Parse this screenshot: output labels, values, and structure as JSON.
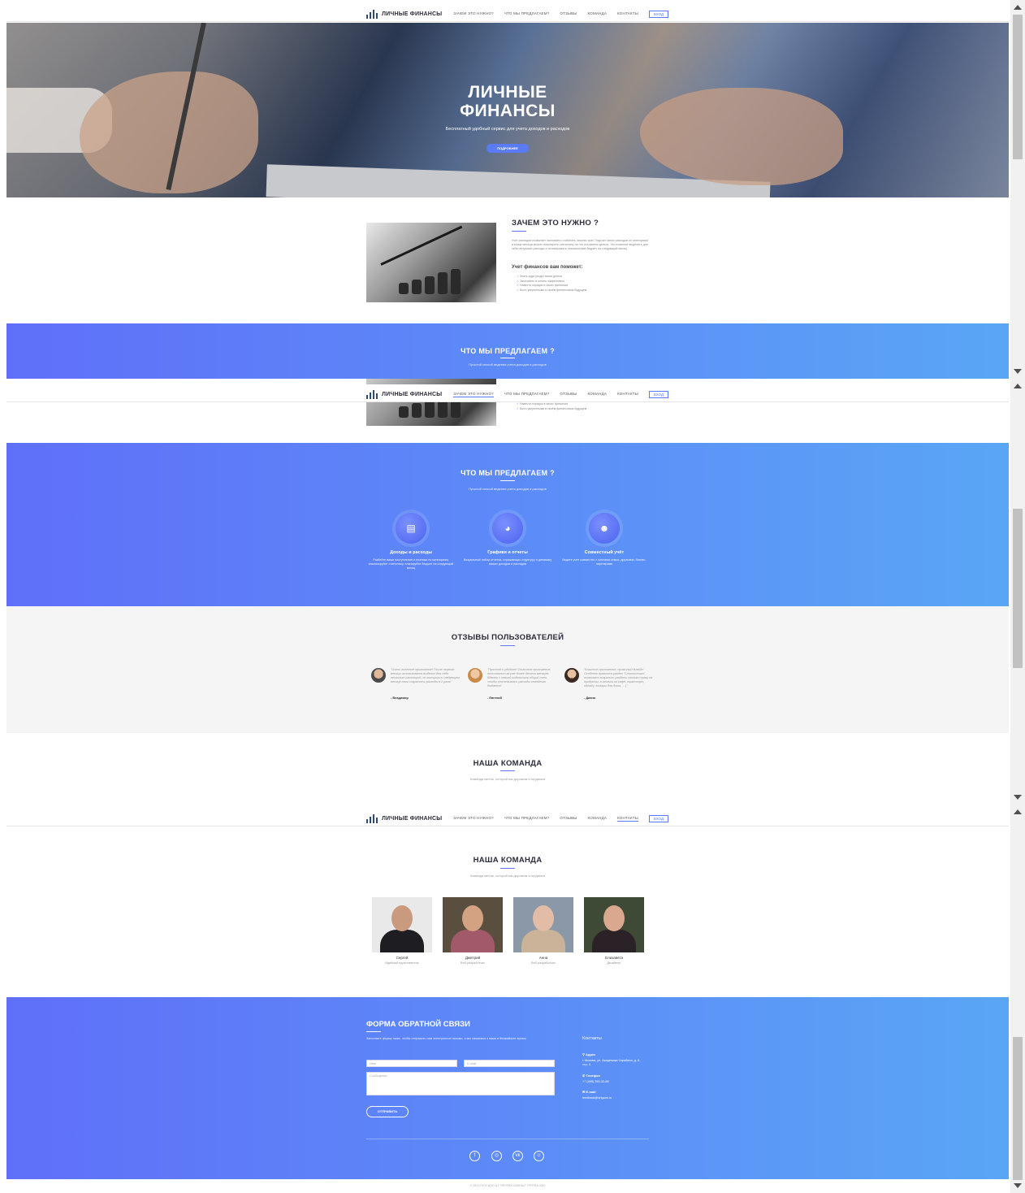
{
  "nav": {
    "brand": "ЛИЧНЫЕ ФИНАНСЫ",
    "links": [
      "ЗАЧЕМ ЭТО НУЖНО?",
      "ЧТО МЫ ПРЕДЛАГАЕМ?",
      "ОТЗЫВЫ",
      "КОМАНДА",
      "КОНТАКТЫ"
    ],
    "login": "ВХОД"
  },
  "hero": {
    "title_line1": "ЛИЧНЫЕ",
    "title_line2": "ФИНАНСЫ",
    "subtitle": "Бесплатный удобный сервис для учета доходов и расходов",
    "button": "ПОДРОБНЕЕ"
  },
  "why": {
    "title": "ЗАЧЕМ ЭТО НУЖНО ?",
    "text": "Учет расходов позволяет экономить и избегать лишних трат. Подсчет своих расходов по категориям в конце месяца можно посмотреть статистику на что потрачены деньги. Это позволит выделить для себя ненужные расходы и спланировать оптимальный бюджет на следующий месяц.",
    "subtitle": "Учет финансов вам поможет:",
    "list": [
      "Знать куда уходят ваши деньги",
      "Экономить и копить эффективно",
      "Навести порядок в своих финансах",
      "Быть уверенными в своём финансовом будущем"
    ],
    "list_short": [
      "Навести порядок в своих финансах",
      "Быть уверенными в своём финансовом будущем"
    ]
  },
  "offer": {
    "title": "ЧТО МЫ ПРЕДЛАГАЕМ ?",
    "subtitle": "Простой способ ведения учета доходов и расходов",
    "features": [
      {
        "icon": "bar-chart-icon",
        "title": "Доходы и расходы",
        "text": "Разбейте ваши поступления и платежи по категориям, анализируйте статистику, планируйте бюджет на следующий месяц"
      },
      {
        "icon": "pie-chart-icon",
        "title": "Графики и отчеты",
        "text": "Визуальный набор отчетов, отражающих структуру и динамику ваших доходов и расходов"
      },
      {
        "icon": "users-icon",
        "title": "Совместный учёт",
        "text": "Ведите учет совместно с членами семьи, друзьями, бизнес-партнерами"
      }
    ]
  },
  "reviews": {
    "title": "ОТЗЫВЫ  ПОЛЬЗОВАТЕЛЕЙ",
    "items": [
      {
        "text": "\"Очень полезное приложение! После первого месяца использования выделил для себя несколько категорий, по которым в следующем месяце смог сократить расходы в 2 раза!\"",
        "author": "- Владимир"
      },
      {
        "text": "\"Простое и удобное! Отличное приложение, пользовался им уже более десяти месяцев. Вдвоем с семьей подключили общий счет, чтобы отслеживать расходы семейного бюджета\"",
        "author": "- Евгений"
      },
      {
        "text": "\"Классное приложение, приятный дизайн! Особенно нравится раздел \"Статистика\", позволяет визуально увидеть сколько трачу на продукты, а сколько на кафе, транспорт, одежду, товары для дома, ... )\"",
        "author": "- Диана"
      }
    ]
  },
  "team": {
    "title": "НАША КОМАНДА",
    "subtitle": "Команда мечты, которой мы дорожим и гордимся",
    "members": [
      {
        "name": "Сергей",
        "role": "Идейный вдохновитель"
      },
      {
        "name": "Дмитрий",
        "role": "Веб-разработчик"
      },
      {
        "name": "Анна",
        "role": "Веб-разработчик"
      },
      {
        "name": "Елизавета",
        "role": "Дизайнер"
      }
    ]
  },
  "contact": {
    "title": "ФОРМА ОБРАТНОЙ СВЯЗИ",
    "text": "Заполните форму ниже, чтобы отправить нам электронное письмо, и мы свяжемся с вами в ближайшее время.",
    "name_placeholder": "Имя",
    "email_placeholder": "E-mail",
    "message_placeholder": "Сообщение",
    "send": "ОТПРАВИТЬ",
    "info_title": "Контакты",
    "address_label": "Адрес",
    "address": "г. Москва, ул. Академика Скрябина, д. 8, стр. 4",
    "phone_label": "Телефон",
    "phone": "+7 (495) 390-33-88",
    "email_label": "E-mail",
    "email": "feedback@origami.ru",
    "socials": [
      "facebook-icon",
      "instagram-icon",
      "vk-icon",
      "odnoklassniki-icon"
    ]
  },
  "footer": "© 2021 ГБОУ ДПО ЦТ \"ПРОФЕССИОНАЛ\" ГРУППА 0000",
  "colors": {
    "accent": "#5a7bf5",
    "gradient_start": "#5f6ff9",
    "gradient_end": "#5aa6f6"
  }
}
